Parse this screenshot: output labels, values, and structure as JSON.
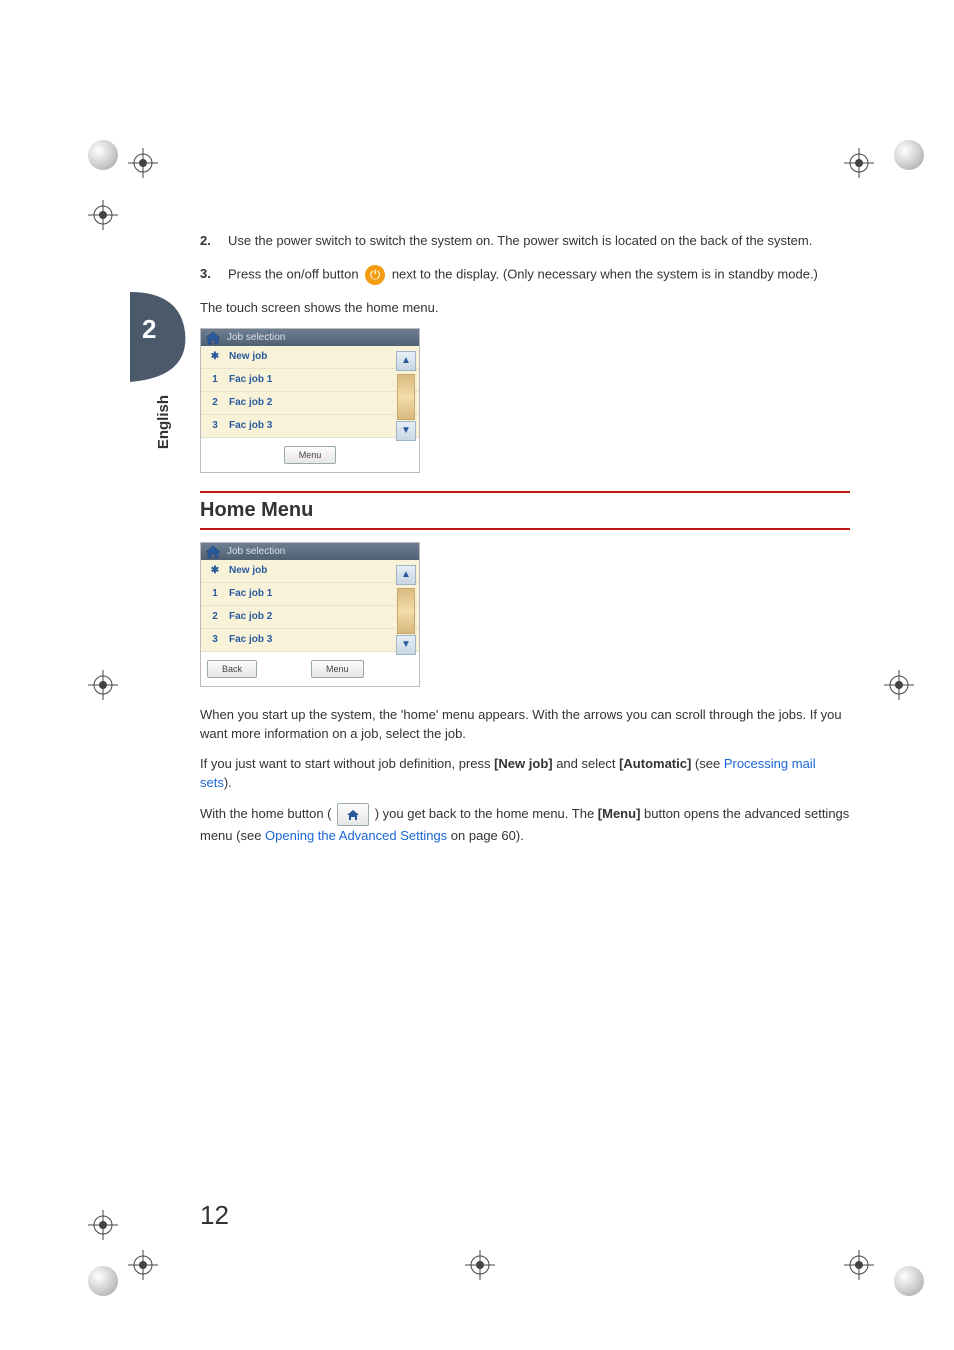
{
  "language_tab": "English",
  "chapter_number": "2",
  "steps": [
    {
      "num": "2.",
      "text": "Use the power switch to switch the system on. The power switch is located on the back of the system."
    },
    {
      "num": "3.",
      "text_before": "Press the on/off button ",
      "text_after": " next to the display. (Only necessary when the system is in standby mode.)"
    }
  ],
  "touch_intro": "The touch screen shows the home menu.",
  "touchscreen1": {
    "title": "Job selection",
    "rows": [
      {
        "idx": "✱",
        "label": "New job"
      },
      {
        "idx": "1",
        "label": "Fac job 1"
      },
      {
        "idx": "2",
        "label": "Fac job 2"
      },
      {
        "idx": "3",
        "label": "Fac job 3"
      }
    ],
    "menu": "Menu"
  },
  "section_heading": "Home Menu",
  "touchscreen2": {
    "title": "Job selection",
    "rows": [
      {
        "idx": "✱",
        "label": "New job"
      },
      {
        "idx": "1",
        "label": "Fac job 1"
      },
      {
        "idx": "2",
        "label": "Fac job 2"
      },
      {
        "idx": "3",
        "label": "Fac job 3"
      }
    ],
    "back": "Back",
    "menu": "Menu"
  },
  "para1": "When you start up the system, the 'home' menu appears. With the arrows you can scroll through the jobs. If you want more information on a job, select the job.",
  "para2": {
    "a": "If you just want to start without job definition, press ",
    "b": "[New job]",
    "c": " and select ",
    "d": "[Automatic]",
    "e": " (see ",
    "link": "Processing mail sets",
    "f": ")."
  },
  "para3": {
    "a": "With the home button ( ",
    "b": " ) you get back to the home menu. The ",
    "c": "[Menu]",
    "d": " button opens the advanced settings menu (see ",
    "link": "Opening the Advanced Settings",
    "e": " on page 60)."
  },
  "page_number": "12"
}
